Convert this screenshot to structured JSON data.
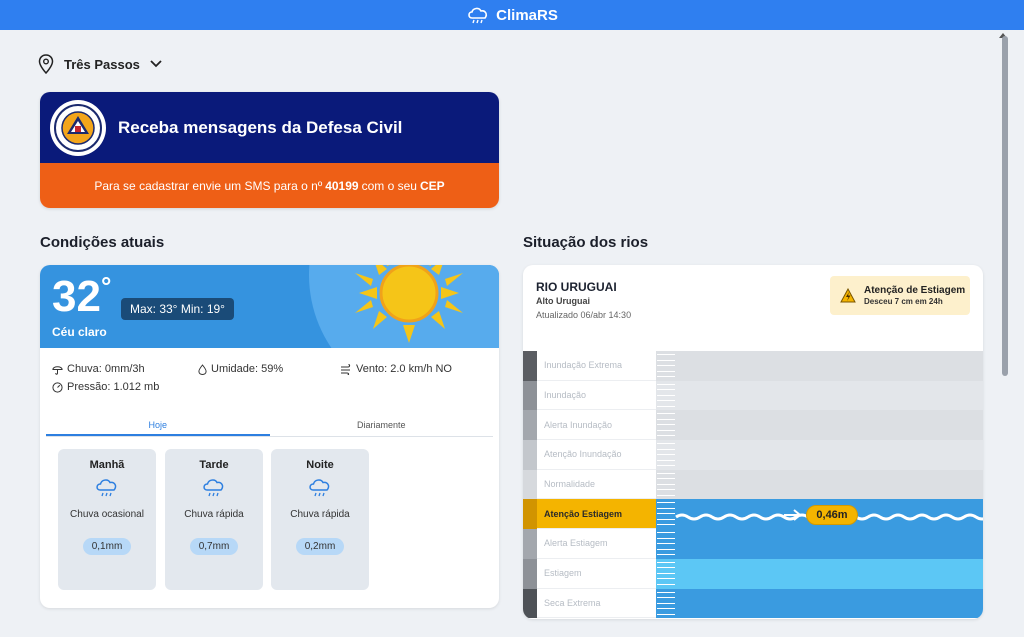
{
  "app": {
    "title": "ClimaRS"
  },
  "location": {
    "name": "Três Passos"
  },
  "banner": {
    "title": "Receba mensagens da Defesa Civil",
    "sms_prefix": "Para se cadastrar envie um SMS para o nº",
    "sms_number": "40199",
    "sms_middle": "com o seu",
    "sms_suffix": "CEP"
  },
  "current": {
    "section_title": "Condições atuais",
    "temperature": "32",
    "degree": "°",
    "minmax": "Max: 33° Min: 19°",
    "condition": "Céu claro",
    "rain": "Chuva: 0mm/3h",
    "humidity": "Umidade: 59%",
    "wind": "Vento: 2.0 km/h NO",
    "pressure": "Pressão: 1.012 mb",
    "tabs": [
      {
        "label": "Hoje",
        "active": true
      },
      {
        "label": "Diariamente",
        "active": false
      }
    ],
    "periods": [
      {
        "title": "Manhã",
        "desc": "Chuva ocasional",
        "rain": "0,1mm",
        "icon": "rain-cloud-icon"
      },
      {
        "title": "Tarde",
        "desc": "Chuva rápida",
        "rain": "0,7mm",
        "icon": "rain-cloud-icon"
      },
      {
        "title": "Noite",
        "desc": "Chuva rápida",
        "rain": "0,2mm",
        "icon": "rain-cloud-icon"
      }
    ]
  },
  "rivers": {
    "section_title": "Situação dos rios",
    "name": "RIO URUGUAI",
    "sub": "Alto Uruguai",
    "updated": "Atualizado 06/abr 14:30",
    "alert_title": "Atenção de Estiagem",
    "alert_sub": "Desceu 7 cm em 24h",
    "current_level": "0,46m",
    "levels": [
      {
        "label": "Inundação Extrema",
        "strip": "#5a5d62",
        "fill": "#dcdfe3",
        "active": false
      },
      {
        "label": "Inundação",
        "strip": "#8d9197",
        "fill": "#e3e6ea",
        "active": false
      },
      {
        "label": "Alerta Inundação",
        "strip": "#a3a7ad",
        "fill": "#dcdfe3",
        "active": false
      },
      {
        "label": "Atenção Inundação",
        "strip": "#c3c7cc",
        "fill": "#e3e6ea",
        "active": false
      },
      {
        "label": "Normalidade",
        "strip": "#d6d9dd",
        "fill": "#dcdfe3",
        "active": false
      },
      {
        "label": "Atenção Estiagem",
        "strip": "#d19400",
        "fill": "#3a9be0",
        "active": true
      },
      {
        "label": "Alerta Estiagem",
        "strip": "#a3a7ad",
        "fill": "#3a9be0",
        "active": false
      },
      {
        "label": "Estiagem",
        "strip": "#8d9197",
        "fill": "#5cc7f5",
        "active": false
      },
      {
        "label": "Seca Extrema",
        "strip": "#4e5257",
        "fill": "#3a9be0",
        "active": false
      }
    ]
  },
  "colors": {
    "topbar": "#2f7ff0",
    "banner_top": "#0a1a7a",
    "banner_bottom": "#ee5f16",
    "accent": "#2d7fe0",
    "warning": "#f4b400"
  }
}
